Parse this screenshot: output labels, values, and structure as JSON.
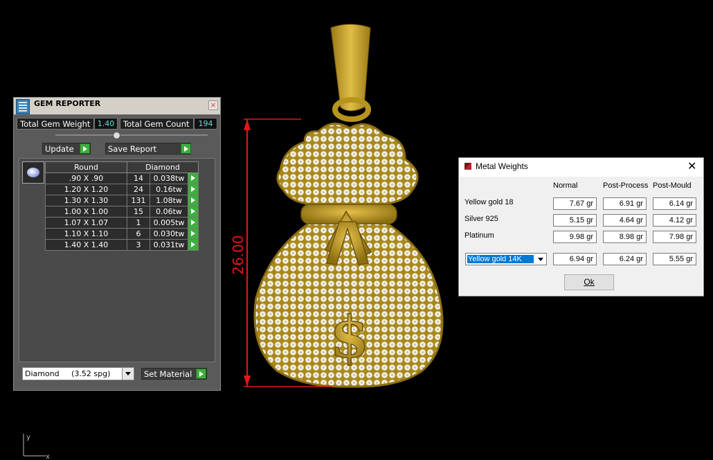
{
  "gem_reporter": {
    "title": "GEM REPORTER",
    "close_glyph": "×",
    "total_gem_weight_label": "Total Gem Weight",
    "total_gem_weight_value": "1.40",
    "total_gem_count_label": "Total Gem Count",
    "total_gem_count_value": "194",
    "update_label": "Update",
    "save_report_label": "Save Report",
    "table_headers": [
      "Round",
      "Diamond"
    ],
    "rows": [
      {
        "size": ".90 X .90",
        "count": "14",
        "weight": "0.038tw"
      },
      {
        "size": "1.20 X 1.20",
        "count": "24",
        "weight": "0.16tw"
      },
      {
        "size": "1.30 X 1.30",
        "count": "131",
        "weight": "1.08tw"
      },
      {
        "size": "1.00 X 1.00",
        "count": "15",
        "weight": "0.06tw"
      },
      {
        "size": "1.07 X 1.07",
        "count": "1",
        "weight": "0.005tw"
      },
      {
        "size": "1.10 X 1.10",
        "count": "6",
        "weight": "0.030tw"
      },
      {
        "size": "1.40 X 1.40",
        "count": "3",
        "weight": "0.031tw"
      }
    ],
    "material_value": "Diamond     (3.52 spg)",
    "set_material_label": "Set Material",
    "icons": [
      "app-icon",
      "close-icon",
      "slider-knob",
      "play-arrow-icon",
      "gem-thumbnail-icon",
      "dropdown-arrow-icon"
    ]
  },
  "render": {
    "dimension_label": "26.00",
    "dimension_color": "#e01818",
    "gold_color": "#c9a227"
  },
  "metal_weights": {
    "title": "Metal Weights",
    "close_glyph": "✕",
    "columns": [
      "Normal",
      "Post-Process",
      "Post-Mould"
    ],
    "rows": [
      {
        "label": "Yellow gold 18",
        "values": [
          "7.67 gr",
          "6.91 gr",
          "6.14 gr"
        ]
      },
      {
        "label": "Silver 925",
        "values": [
          "5.15 gr",
          "4.64 gr",
          "4.12 gr"
        ]
      },
      {
        "label": "Platinum",
        "values": [
          "9.98 gr",
          "8.98 gr",
          "7.98 gr"
        ]
      }
    ],
    "selected_metal": "Yellow gold 14K",
    "selected_values": [
      "6.94 gr",
      "6.24 gr",
      "5.55 gr"
    ],
    "ok_label": "Ok"
  },
  "axis": {
    "x_label": "x",
    "y_label": "y"
  }
}
